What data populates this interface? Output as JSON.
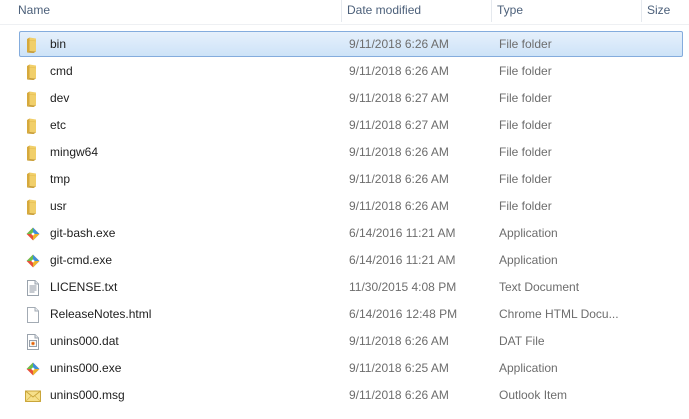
{
  "columns": {
    "name": "Name",
    "date": "Date modified",
    "type": "Type",
    "size": "Size"
  },
  "files": [
    {
      "name": "bin",
      "date": "9/11/2018 6:26 AM",
      "type": "File folder",
      "icon": "folder-icon",
      "selected": true
    },
    {
      "name": "cmd",
      "date": "9/11/2018 6:26 AM",
      "type": "File folder",
      "icon": "folder-icon"
    },
    {
      "name": "dev",
      "date": "9/11/2018 6:27 AM",
      "type": "File folder",
      "icon": "folder-icon"
    },
    {
      "name": "etc",
      "date": "9/11/2018 6:27 AM",
      "type": "File folder",
      "icon": "folder-icon"
    },
    {
      "name": "mingw64",
      "date": "9/11/2018 6:26 AM",
      "type": "File folder",
      "icon": "folder-icon"
    },
    {
      "name": "tmp",
      "date": "9/11/2018 6:26 AM",
      "type": "File folder",
      "icon": "folder-icon"
    },
    {
      "name": "usr",
      "date": "9/11/2018 6:26 AM",
      "type": "File folder",
      "icon": "folder-icon"
    },
    {
      "name": "git-bash.exe",
      "date": "6/14/2016 11:21 AM",
      "type": "Application",
      "icon": "git-diamond-icon"
    },
    {
      "name": "git-cmd.exe",
      "date": "6/14/2016 11:21 AM",
      "type": "Application",
      "icon": "git-diamond-icon"
    },
    {
      "name": "LICENSE.txt",
      "date": "11/30/2015 4:08 PM",
      "type": "Text Document",
      "icon": "text-document-icon"
    },
    {
      "name": "ReleaseNotes.html",
      "date": "6/14/2016 12:48 PM",
      "type": "Chrome HTML Docu...",
      "icon": "blank-document-icon"
    },
    {
      "name": "unins000.dat",
      "date": "9/11/2018 6:26 AM",
      "type": "DAT File",
      "icon": "dat-file-icon"
    },
    {
      "name": "unins000.exe",
      "date": "9/11/2018 6:25 AM",
      "type": "Application",
      "icon": "git-diamond-icon"
    },
    {
      "name": "unins000.msg",
      "date": "9/11/2018 6:26 AM",
      "type": "Outlook Item",
      "icon": "envelope-icon"
    }
  ],
  "colors": {
    "selection_fill": "#cde3f8",
    "selection_border": "#84acdd",
    "header_text": "#4c607a",
    "meta_text": "#6d6d6d"
  }
}
